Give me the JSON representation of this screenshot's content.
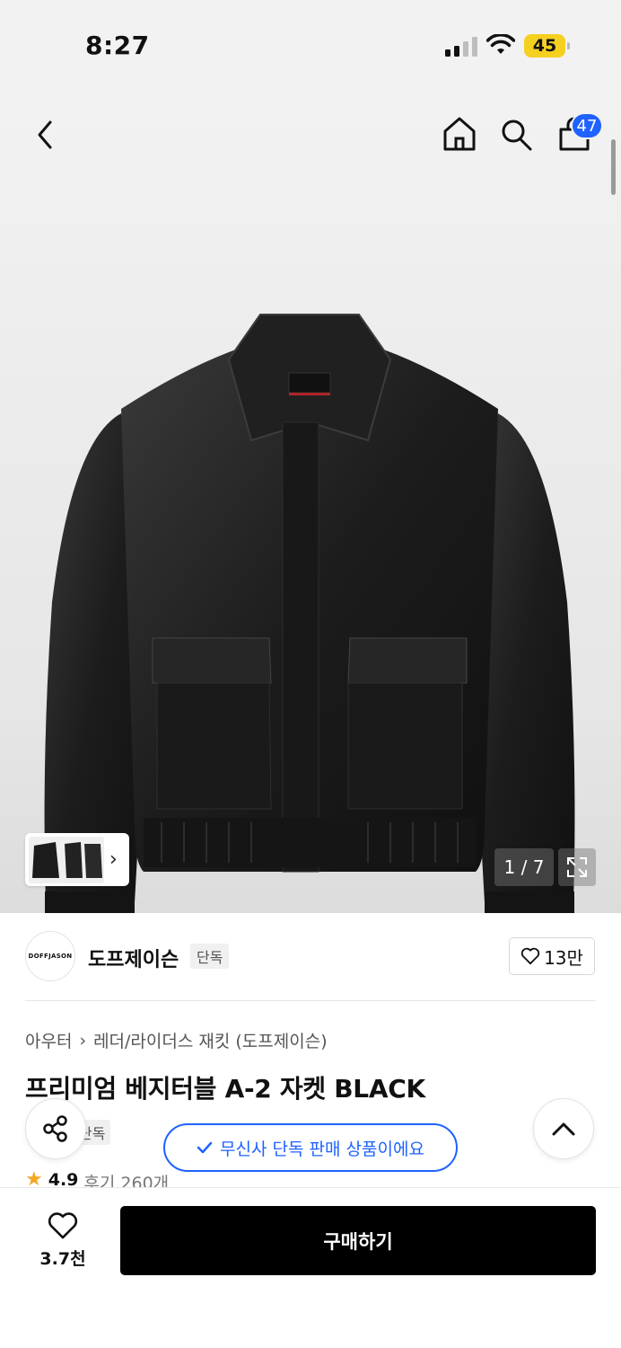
{
  "status_bar": {
    "time": "8:27",
    "battery": "45"
  },
  "header": {
    "cart_count": "47"
  },
  "gallery": {
    "counter": "1 / 7"
  },
  "brand": {
    "logo_text": "DOFFJASON",
    "name": "도프제이슨",
    "badge": "단독",
    "like_count": "13만"
  },
  "breadcrumb": {
    "category": "아우터",
    "subcategory": "레더/라이더스 재킷 (도프제이슨)"
  },
  "product": {
    "title": "프리미엄 베지터블 A-2 자켓 BLACK",
    "exclusive_badge": "단독",
    "rating": "4.9",
    "reviews": "후기 260개"
  },
  "toast": {
    "message": "무신사 단독 판매 상품이에요"
  },
  "bottom_bar": {
    "wish_count": "3.7천",
    "buy_label": "구매하기"
  },
  "colors": {
    "accent": "#1f62ff",
    "battery": "#f5d020",
    "star": "#f5a623",
    "buy": "#000000"
  },
  "icons": [
    "back-icon",
    "home-icon",
    "search-icon",
    "cart-icon",
    "expand-icon",
    "share-icon",
    "chevron-up-icon",
    "heart-icon",
    "check-icon",
    "star-icon"
  ]
}
